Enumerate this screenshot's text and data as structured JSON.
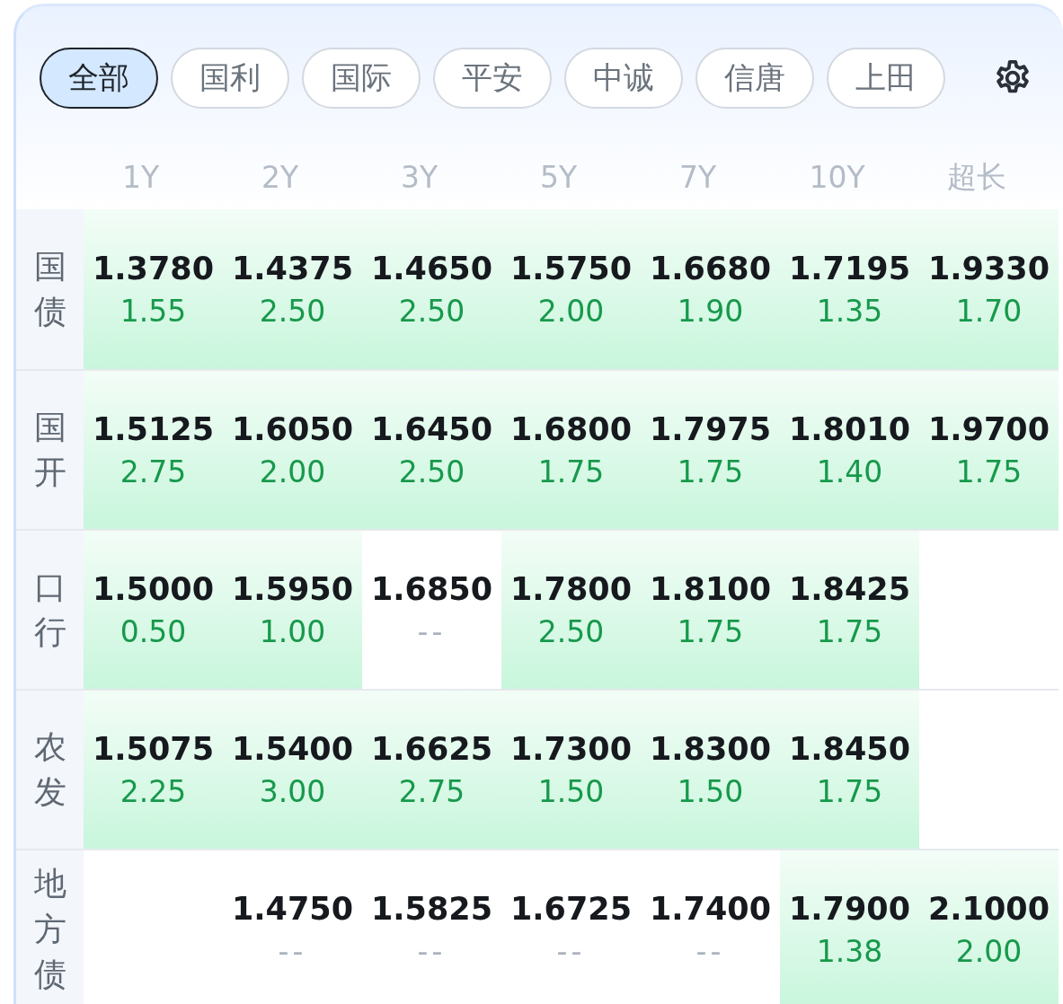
{
  "tabs": [
    {
      "label": "全部",
      "selected": true
    },
    {
      "label": "国利",
      "selected": false
    },
    {
      "label": "国际",
      "selected": false
    },
    {
      "label": "平安",
      "selected": false
    },
    {
      "label": "中诚",
      "selected": false
    },
    {
      "label": "信唐",
      "selected": false
    },
    {
      "label": "上田",
      "selected": false
    }
  ],
  "table": {
    "columns": [
      "1Y",
      "2Y",
      "3Y",
      "5Y",
      "7Y",
      "10Y",
      "超长"
    ],
    "rows": [
      {
        "name": "国债",
        "cells": [
          {
            "kind": "quote",
            "yield": "1.3780",
            "change": "1.55",
            "highlighted": true
          },
          {
            "kind": "quote",
            "yield": "1.4375",
            "change": "2.50",
            "highlighted": true
          },
          {
            "kind": "quote",
            "yield": "1.4650",
            "change": "2.50",
            "highlighted": true
          },
          {
            "kind": "quote",
            "yield": "1.5750",
            "change": "2.00",
            "highlighted": true
          },
          {
            "kind": "quote",
            "yield": "1.6680",
            "change": "1.90",
            "highlighted": true
          },
          {
            "kind": "quote",
            "yield": "1.7195",
            "change": "1.35",
            "highlighted": true
          },
          {
            "kind": "quote",
            "yield": "1.9330",
            "change": "1.70",
            "highlighted": true
          }
        ]
      },
      {
        "name": "国开",
        "cells": [
          {
            "kind": "quote",
            "yield": "1.5125",
            "change": "2.75",
            "highlighted": true
          },
          {
            "kind": "quote",
            "yield": "1.6050",
            "change": "2.00",
            "highlighted": true
          },
          {
            "kind": "quote",
            "yield": "1.6450",
            "change": "2.50",
            "highlighted": true
          },
          {
            "kind": "quote",
            "yield": "1.6800",
            "change": "1.75",
            "highlighted": true
          },
          {
            "kind": "quote",
            "yield": "1.7975",
            "change": "1.75",
            "highlighted": true
          },
          {
            "kind": "quote",
            "yield": "1.8010",
            "change": "1.40",
            "highlighted": true
          },
          {
            "kind": "quote",
            "yield": "1.9700",
            "change": "1.75",
            "highlighted": true
          }
        ]
      },
      {
        "name": "口行",
        "cells": [
          {
            "kind": "quote",
            "yield": "1.5000",
            "change": "0.50",
            "highlighted": true
          },
          {
            "kind": "quote",
            "yield": "1.5950",
            "change": "1.00",
            "highlighted": true
          },
          {
            "kind": "quote",
            "yield": "1.6850",
            "change": "--",
            "highlighted": false
          },
          {
            "kind": "quote",
            "yield": "1.7800",
            "change": "2.50",
            "highlighted": true
          },
          {
            "kind": "quote",
            "yield": "1.8100",
            "change": "1.75",
            "highlighted": true
          },
          {
            "kind": "quote",
            "yield": "1.8425",
            "change": "1.75",
            "highlighted": true
          },
          {
            "kind": "blank"
          }
        ]
      },
      {
        "name": "农发",
        "cells": [
          {
            "kind": "quote",
            "yield": "1.5075",
            "change": "2.25",
            "highlighted": true
          },
          {
            "kind": "quote",
            "yield": "1.5400",
            "change": "3.00",
            "highlighted": true
          },
          {
            "kind": "quote",
            "yield": "1.6625",
            "change": "2.75",
            "highlighted": true
          },
          {
            "kind": "quote",
            "yield": "1.7300",
            "change": "1.50",
            "highlighted": true
          },
          {
            "kind": "quote",
            "yield": "1.8300",
            "change": "1.50",
            "highlighted": true
          },
          {
            "kind": "quote",
            "yield": "1.8450",
            "change": "1.75",
            "highlighted": true
          },
          {
            "kind": "blank"
          }
        ]
      },
      {
        "name": "地方债",
        "cells": [
          {
            "kind": "blank"
          },
          {
            "kind": "quote",
            "yield": "1.4750",
            "change": "--",
            "highlighted": false
          },
          {
            "kind": "quote",
            "yield": "1.5825",
            "change": "--",
            "highlighted": false
          },
          {
            "kind": "quote",
            "yield": "1.6725",
            "change": "--",
            "highlighted": false
          },
          {
            "kind": "quote",
            "yield": "1.7400",
            "change": "--",
            "highlighted": false
          },
          {
            "kind": "quote",
            "yield": "1.7900",
            "change": "1.38",
            "highlighted": true
          },
          {
            "kind": "quote",
            "yield": "2.1000",
            "change": "2.00",
            "highlighted": true
          }
        ]
      }
    ]
  }
}
